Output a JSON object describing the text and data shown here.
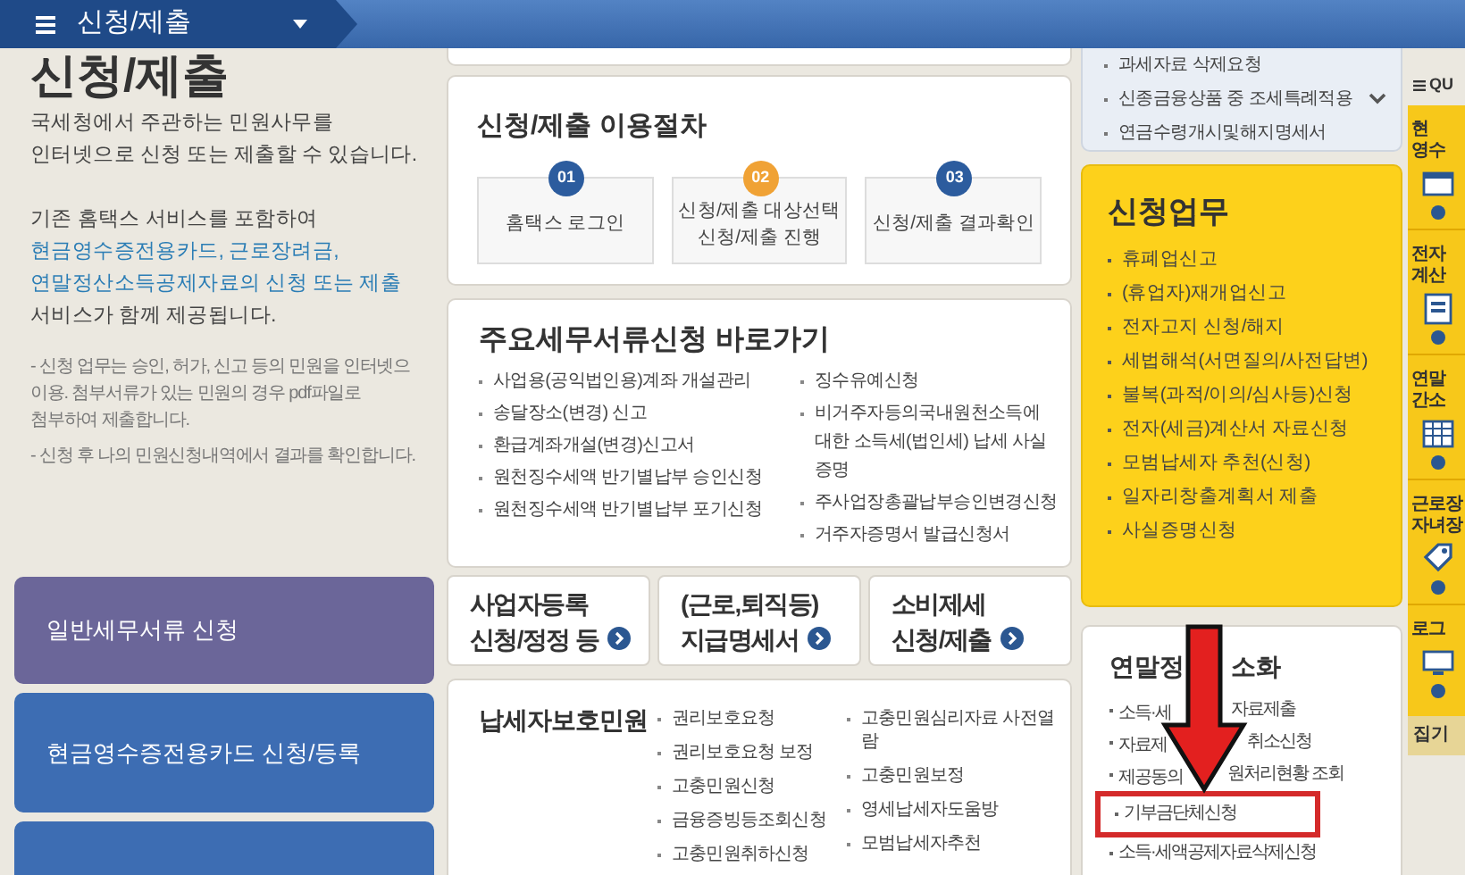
{
  "top_bar": {
    "menu_title": "신청/제출"
  },
  "intro": {
    "heading": "신청/제출",
    "text_1": [
      "국세청에서 주관하는 민원사무를",
      "인터넷으로 신청 또는 제출할 수 있습니다."
    ],
    "text_2": [
      {
        "text": "기존 홈택스 서비스를 포함하여",
        "highlight": false
      },
      {
        "text": "현금영수증전용카드, 근로장려금,",
        "highlight": true
      },
      {
        "text": "연말정산소득공제자료의 신청 또는 제출",
        "highlight": true
      },
      {
        "text": "서비스가 함께 제공됩니다.",
        "highlight": false
      }
    ],
    "notes": [
      [
        "- 신청 업무는 승인, 허가, 신고 등의 민원을 인터넷으",
        "이용. 첨부서류가 있는 민원의 경우 pdf파일로",
        "첨부하여 제출합니다."
      ],
      [
        "- 신청 후 나의 민원신청내역에서 결과를 확인합니다."
      ]
    ]
  },
  "left_menu": [
    {
      "label": "일반세무서류 신청",
      "color": "#6b6699"
    },
    {
      "label": "현금영수증전용카드 신청/등록",
      "color": "#3d6db3"
    },
    {
      "color": "#3d6db3"
    }
  ],
  "procedure": {
    "title": "신청/제출 이용절차",
    "steps": [
      {
        "number": "01",
        "lines": [
          "홈택스 로그인"
        ],
        "current": false
      },
      {
        "number": "02",
        "lines": [
          "신청/제출 대상선택",
          "신청/제출 진행"
        ],
        "current": true
      },
      {
        "number": "03",
        "lines": [
          "신청/제출 결과확인"
        ],
        "current": false
      }
    ]
  },
  "shortcuts": {
    "title": "주요세무서류신청 바로가기",
    "column_1": [
      "사업용(공익법인용)계좌 개설관리",
      "송달장소(변경) 신고",
      "환급계좌개설(변경)신고서",
      "원천징수세액 반기별납부 승인신청",
      "원천징수세액 반기별납부 포기신청"
    ],
    "column_2": [
      "징수유예신청",
      "비거주자등의국내원천소득에 대한 소득세(법인세) 납세 사실증명",
      "주사업장총괄납부승인변경신청",
      "거주자증명서 발급신청서"
    ]
  },
  "service_tiles": [
    {
      "lines": [
        "사업자등록",
        "신청/정정 등"
      ]
    },
    {
      "lines": [
        "(근로,퇴직등)",
        "지급명세서"
      ]
    },
    {
      "lines": [
        "소비제세",
        "신청/제출"
      ]
    }
  ],
  "taxpayer_protection": {
    "title": "납세자보호민원",
    "column_1": [
      "권리보호요청",
      "권리보호요청 보정",
      "고충민원신청",
      "금융증빙등조회신청",
      "고충민원취하신청"
    ],
    "column_2": [
      "고충민원심리자료 사전열람",
      "고충민원보정",
      "영세납세자도움방",
      "모범납세자추천"
    ]
  },
  "top_list": {
    "items": [
      "과세자료 삭제요청",
      "신종금융상품 중 조세특례적용",
      "연금수령개시및해지명세서"
    ]
  },
  "application_tasks": {
    "title": "신청업무",
    "items": [
      "휴폐업신고",
      "(휴업자)재개업신고",
      "전자고지 신청/해지",
      "세법해석(서면질의/사전답변)",
      "불복(과적/이의/심사등)신청",
      "전자(세금)계산서 자료신청",
      "모범납세자 추천(신청)",
      "일자리창출계획서 제출",
      "사실증명신청"
    ]
  },
  "year_end": {
    "title_parts": [
      "연말정",
      "소화"
    ],
    "pointer_arrow": true,
    "items": [
      {
        "parts": [
          "소득·세",
          "자료제출"
        ],
        "highlighted": false
      },
      {
        "parts": [
          "자료제",
          "취소신청"
        ],
        "highlighted": false
      },
      {
        "parts": [
          "제공동의",
          "원처리현황 조회"
        ],
        "highlighted": false
      },
      {
        "parts": [
          "기부금단체신청"
        ],
        "highlighted": true
      },
      {
        "parts": [
          "소득·세액공제자료삭제신청"
        ],
        "highlighted": false
      }
    ]
  },
  "quick_menu": {
    "title": "QU",
    "items": [
      {
        "lines": [
          "현",
          "영수"
        ],
        "kind": "receipt"
      },
      {
        "lines": [
          "전자",
          "계산"
        ],
        "kind": "document"
      },
      {
        "lines": [
          "연말",
          "간소"
        ],
        "kind": "table"
      },
      {
        "lines": [
          "근로장",
          "자녀장"
        ],
        "kind": "tag"
      },
      {
        "lines": [
          "로그"
        ],
        "kind": "monitor"
      }
    ],
    "footer": "집기"
  }
}
